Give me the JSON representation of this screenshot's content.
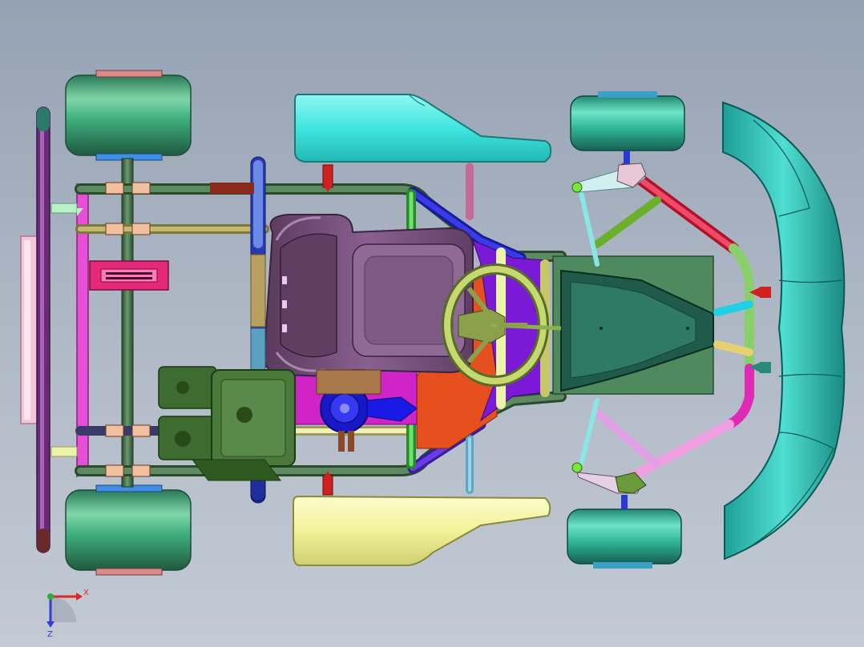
{
  "viewport": {
    "background_top": "#95a2b3",
    "background_bottom": "#c3cad4"
  },
  "triad": {
    "x_label": "X",
    "z_label": "Z",
    "x_color": "#e0262a",
    "z_color": "#2f3fd6",
    "y_color": "#2fae3a"
  },
  "colors": {
    "tire": "#3fae7c",
    "frame_green": "#3d6d44",
    "sidepod_front": "#3fe6e0",
    "sidepod_rear": "#f7f7a6",
    "seat": "#6e4a6e",
    "nose": "#2fc6bc",
    "floor_tray": "#2e6a56",
    "steering_wheel": "#a8c25a",
    "engine": "#3d6b30",
    "carb_blue": "#1818c8",
    "bumper": "#6a2a78"
  },
  "parts": [
    "rear-wheel-left",
    "rear-wheel-right",
    "front-wheel-left",
    "front-wheel-right",
    "rear-axle",
    "rear-bumper",
    "chassis-frame",
    "seat",
    "engine",
    "steering-wheel",
    "front-nose",
    "sidepod-front",
    "sidepod-rear",
    "floor-tray"
  ]
}
